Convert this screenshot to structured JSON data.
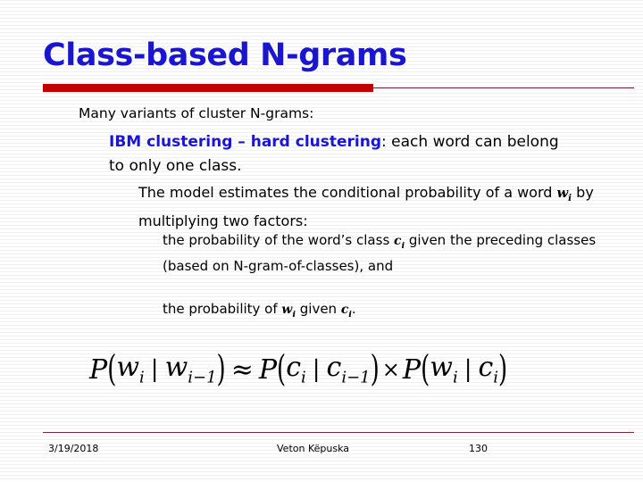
{
  "slide": {
    "title": "Class-based N-grams",
    "accent_blue": "#1a16cf",
    "accent_red": "#c00000",
    "rule_dark_red": "#6b1b2a"
  },
  "bullets": {
    "level1": {
      "icon": "red-diamond-bullet-icon",
      "text": "Many variants of cluster N-grams:"
    },
    "level2": {
      "icon": "blue-square-bullet-icon",
      "lead": "IBM clustering – hard clustering",
      "rest": ": each word can belong to only one class."
    },
    "level3": {
      "icon": "red-diamond-bullet-icon",
      "part1": "The model estimates the conditional probability of a word ",
      "var": "w",
      "var_sub": "i",
      "part2": " by multiplying two factors:"
    },
    "level4a": {
      "icon": "blue-square-bullet-icon",
      "part1": "the probability of the word’s class ",
      "var": "c",
      "var_sub": "i",
      "part2": " given the preceding classes (based on N-gram-of-classes), and"
    },
    "level4b": {
      "icon": "blue-square-bullet-icon",
      "part1": "the probability of ",
      "var1": "w",
      "var1_sub": "i",
      "part2": " given ",
      "var2": "c",
      "var2_sub": "i",
      "part3": "."
    }
  },
  "equation": {
    "plain": "P(w_i | w_{i-1}) ≈ P(c_i | c_{i-1}) × P(w_i | c_i)",
    "p1": "P",
    "v1": "w",
    "v1_sub": "i",
    "v2": "w",
    "v2_sub": "i−1",
    "approx": "≈",
    "p2": "P",
    "v3": "c",
    "v3_sub": "i",
    "v4": "c",
    "v4_sub": "i−1",
    "times": "×",
    "p3": "P",
    "v5": "w",
    "v5_sub": "i",
    "v6": "c",
    "v6_sub": "i",
    "bar": "|",
    "lparen": "(",
    "rparen": ")"
  },
  "footer": {
    "date": "3/19/2018",
    "author": "Veton Këpuska",
    "page": "130"
  }
}
